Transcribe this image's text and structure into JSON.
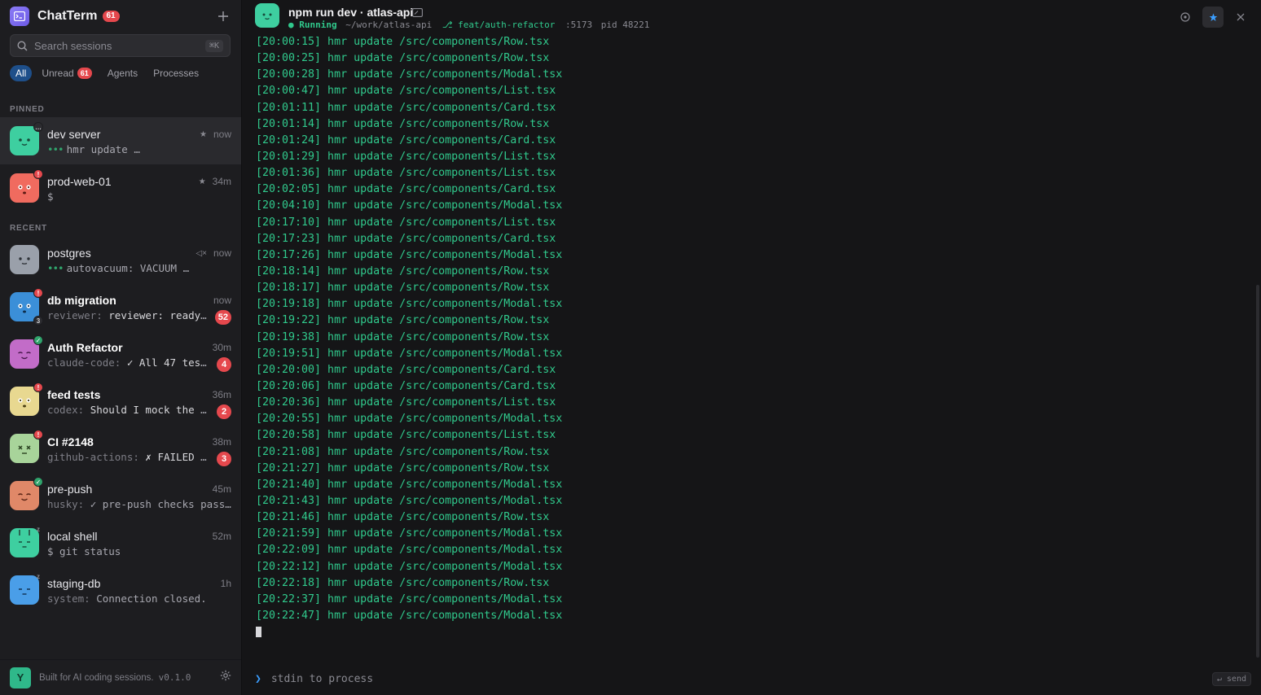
{
  "app": {
    "title": "ChatTerm",
    "unread_total": "61",
    "new_session_icon": "plus-icon"
  },
  "search": {
    "placeholder": "Search sessions",
    "shortcut": "⌘K"
  },
  "filters": [
    {
      "label": "All"
    },
    {
      "label": "Unread",
      "count": "61"
    },
    {
      "label": "Agents"
    },
    {
      "label": "Processes"
    }
  ],
  "sections": {
    "pinned": "PINNED",
    "recent": "RECENT"
  },
  "sessions": [
    {
      "name": "dev server",
      "time": "now",
      "pinned": true,
      "preview_body": "hmr update …",
      "avatar_color": "#3ecfa0",
      "badge": "…"
    },
    {
      "name": "prod-web-01",
      "time": "34m",
      "pinned": true,
      "preview_body": "$",
      "avatar_color": "#f06b5f",
      "badge": "!"
    },
    {
      "name": "postgres",
      "time": "now",
      "muted": true,
      "preview_body": "autovacuum: VACUUM …",
      "avatar_color": "#9aa0aa"
    },
    {
      "name": "db migration",
      "time": "now",
      "preview_who": "reviewer:",
      "preview_body": "reviewer: ready …",
      "unread": "52",
      "avatar_color": "#3b8fd8",
      "badge": "!",
      "sub_badge": "3"
    },
    {
      "name": "Auth Refactor",
      "time": "30m",
      "preview_who": "claude-code:",
      "preview_body": "✓ All 47 tests…",
      "unread": "4",
      "avatar_color": "#c26cc8",
      "badge": "✓"
    },
    {
      "name": "feed tests",
      "time": "36m",
      "preview_who": "codex:",
      "preview_body": "Should I mock the Re…",
      "unread": "2",
      "avatar_color": "#e8d890",
      "badge": "!"
    },
    {
      "name": "CI #2148",
      "time": "38m",
      "preview_who": "github-actions:",
      "preview_body": "✗ FAILED · …",
      "unread": "3",
      "avatar_color": "#a8d49a",
      "badge": "!"
    },
    {
      "name": "pre-push",
      "time": "45m",
      "preview_who": "husky:",
      "preview_body": "✓ pre-push checks passe…",
      "avatar_color": "#e08868",
      "badge": "✓"
    },
    {
      "name": "local shell",
      "time": "52m",
      "preview_body": "$ git status",
      "avatar_color": "#3ecfa0",
      "badge": "z"
    },
    {
      "name": "staging-db",
      "time": "1h",
      "preview_who": "system:",
      "preview_body": "Connection closed.",
      "avatar_color": "#4a9ee8",
      "badge": "z"
    }
  ],
  "footer": {
    "user_initial": "Y",
    "text": "Built for AI coding sessions.",
    "version": "v0.1.0"
  },
  "terminal": {
    "title": "npm run dev · atlas-api",
    "status": "Running",
    "cwd": "~/work/atlas-api",
    "branch": "feat/auth-refactor",
    "port": ":5173",
    "pid": "pid 48221",
    "log": [
      "[20:00:15] hmr update /src/components/Row.tsx",
      "[20:00:25] hmr update /src/components/Row.tsx",
      "[20:00:28] hmr update /src/components/Modal.tsx",
      "[20:00:47] hmr update /src/components/List.tsx",
      "[20:01:11] hmr update /src/components/Card.tsx",
      "[20:01:14] hmr update /src/components/Row.tsx",
      "[20:01:24] hmr update /src/components/Card.tsx",
      "[20:01:29] hmr update /src/components/List.tsx",
      "[20:01:36] hmr update /src/components/List.tsx",
      "[20:02:05] hmr update /src/components/Card.tsx",
      "[20:04:10] hmr update /src/components/Modal.tsx",
      "[20:17:10] hmr update /src/components/List.tsx",
      "[20:17:23] hmr update /src/components/Card.tsx",
      "[20:17:26] hmr update /src/components/Modal.tsx",
      "[20:18:14] hmr update /src/components/Row.tsx",
      "[20:18:17] hmr update /src/components/Row.tsx",
      "[20:19:18] hmr update /src/components/Modal.tsx",
      "[20:19:22] hmr update /src/components/Row.tsx",
      "[20:19:38] hmr update /src/components/Row.tsx",
      "[20:19:51] hmr update /src/components/Modal.tsx",
      "[20:20:00] hmr update /src/components/Card.tsx",
      "[20:20:06] hmr update /src/components/Card.tsx",
      "[20:20:36] hmr update /src/components/List.tsx",
      "[20:20:55] hmr update /src/components/Modal.tsx",
      "[20:20:58] hmr update /src/components/List.tsx",
      "[20:21:08] hmr update /src/components/Row.tsx",
      "[20:21:27] hmr update /src/components/Row.tsx",
      "[20:21:40] hmr update /src/components/Modal.tsx",
      "[20:21:43] hmr update /src/components/Modal.tsx",
      "[20:21:46] hmr update /src/components/Row.tsx",
      "[20:21:59] hmr update /src/components/Modal.tsx",
      "[20:22:09] hmr update /src/components/Modal.tsx",
      "[20:22:12] hmr update /src/components/Modal.tsx",
      "[20:22:18] hmr update /src/components/Row.tsx",
      "[20:22:37] hmr update /src/components/Modal.tsx",
      "[20:22:47] hmr update /src/components/Modal.tsx"
    ]
  },
  "input": {
    "placeholder": "stdin to process",
    "send_hint": "↵ send"
  },
  "colors": {
    "accent": "#3b9eff",
    "terminal_text": "#30c98c",
    "badge_red": "#e5484d",
    "success": "#30a46c"
  }
}
